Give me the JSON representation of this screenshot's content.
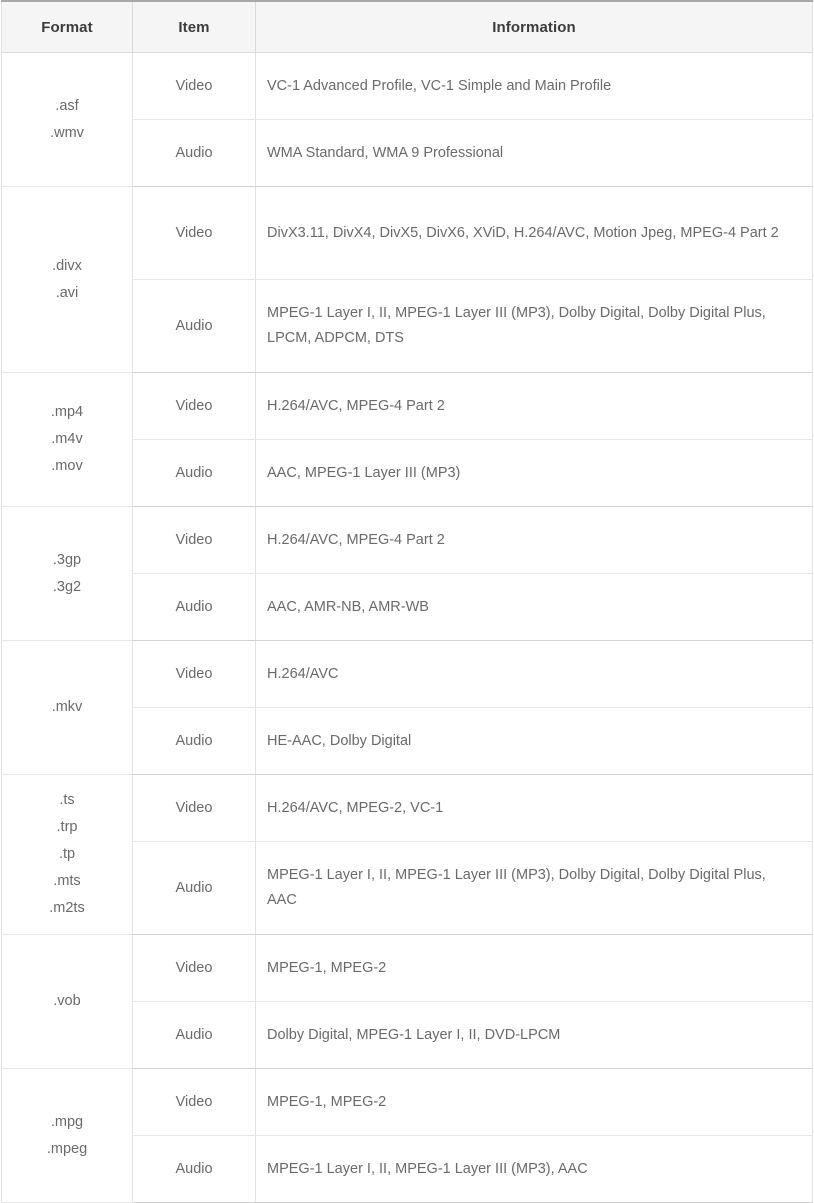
{
  "table": {
    "columns": [
      {
        "key": "format",
        "label": "Format"
      },
      {
        "key": "item",
        "label": "Item"
      },
      {
        "key": "information",
        "label": "Information"
      }
    ],
    "item_labels": {
      "video": "Video",
      "audio": "Audio"
    },
    "groups": [
      {
        "formats": [
          ".asf",
          ".wmv"
        ],
        "video": "VC-1 Advanced Profile, VC-1 Simple and Main Profile",
        "audio": "WMA Standard, WMA 9 Professional",
        "video_lines": 1,
        "audio_lines": 1
      },
      {
        "formats": [
          ".divx",
          ".avi"
        ],
        "video": "DivX3.11, DivX4, DivX5, DivX6, XViD, H.264/AVC, Motion Jpeg, MPEG-4 Part 2",
        "audio": "MPEG-1 Layer I, II, MPEG-1 Layer III (MP3), Dolby Digital, Dolby Digital Plus, LPCM, ADPCM, DTS",
        "video_lines": 2,
        "audio_lines": 2
      },
      {
        "formats": [
          ".mp4",
          ".m4v",
          ".mov"
        ],
        "video": "H.264/AVC, MPEG-4 Part 2",
        "audio": "AAC, MPEG-1 Layer III (MP3)",
        "video_lines": 1,
        "audio_lines": 1
      },
      {
        "formats": [
          ".3gp",
          ".3g2"
        ],
        "video": "H.264/AVC, MPEG-4 Part 2",
        "audio": "AAC, AMR-NB, AMR-WB",
        "video_lines": 1,
        "audio_lines": 1
      },
      {
        "formats": [
          ".mkv"
        ],
        "video": "H.264/AVC",
        "audio": "HE-AAC, Dolby Digital",
        "video_lines": 1,
        "audio_lines": 1
      },
      {
        "formats": [
          ".ts",
          ".trp",
          ".tp",
          ".mts",
          ".m2ts"
        ],
        "video": "H.264/AVC, MPEG-2, VC-1",
        "audio": "MPEG-1 Layer I, II, MPEG-1 Layer III (MP3), Dolby Digital, Dolby Digital Plus, AAC",
        "video_lines": 1,
        "audio_lines": 2
      },
      {
        "formats": [
          ".vob"
        ],
        "video": "MPEG-1, MPEG-2",
        "audio": "Dolby Digital, MPEG-1 Layer I, II, DVD-LPCM",
        "video_lines": 1,
        "audio_lines": 1
      },
      {
        "formats": [
          ".mpg",
          ".mpeg"
        ],
        "video": "MPEG-1, MPEG-2",
        "audio": "MPEG-1 Layer I, II, MPEG-1 Layer III (MP3), AAC",
        "video_lines": 1,
        "audio_lines": 1
      }
    ]
  },
  "colors": {
    "header_bg": "#f5f5f5",
    "header_text": "#3c3c3c",
    "body_text": "#6a6a6a",
    "format_text": "#595959",
    "border": "#e2e2e2",
    "group_border": "#d2d2d2",
    "top_rule": "#a8a8a8"
  }
}
